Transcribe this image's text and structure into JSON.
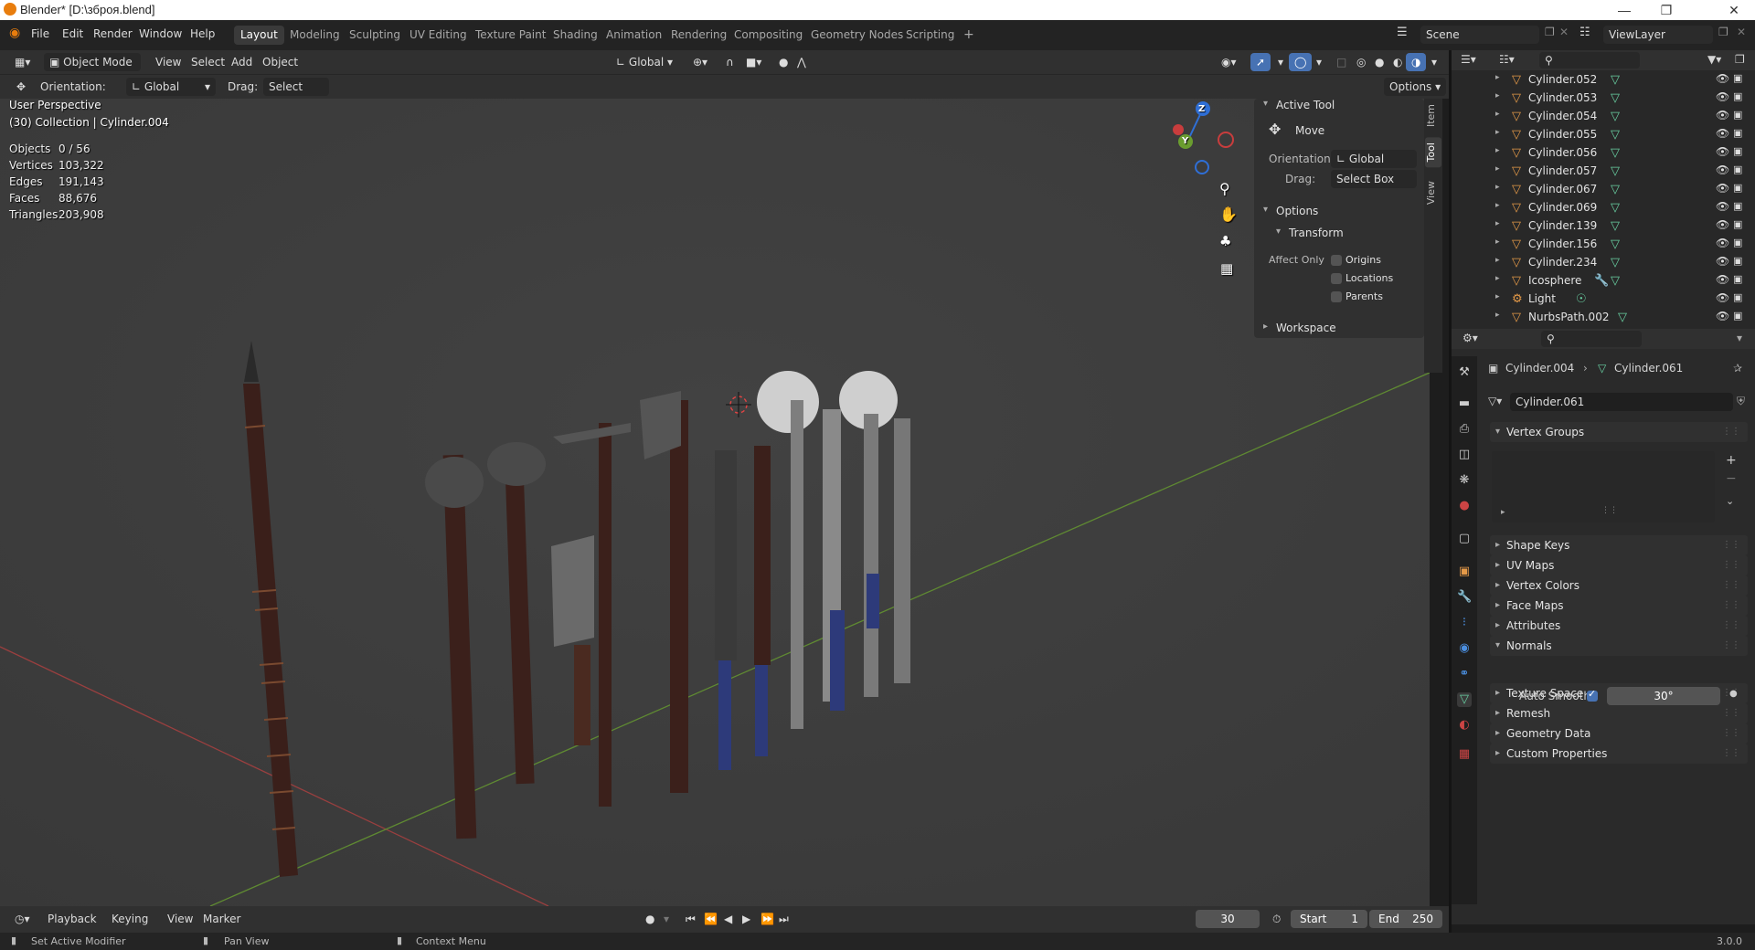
{
  "window": {
    "title": "Blender* [D:\\зброя.blend]"
  },
  "menu": {
    "items": [
      "File",
      "Edit",
      "Render",
      "Window",
      "Help"
    ],
    "workspaces": [
      "Layout",
      "Modeling",
      "Sculpting",
      "UV Editing",
      "Texture Paint",
      "Shading",
      "Animation",
      "Rendering",
      "Compositing",
      "Geometry Nodes",
      "Scripting"
    ],
    "active_workspace": "Layout",
    "add_tab": "+",
    "scene_name": "Scene",
    "view_layer": "ViewLayer"
  },
  "viewport_header": {
    "mode": "Object Mode",
    "menus": [
      "View",
      "Select",
      "Add",
      "Object"
    ],
    "transform_orientation": "Global"
  },
  "tool_header": {
    "orientation_label": "Orientation:",
    "orientation_value": "Global",
    "drag_label": "Drag:",
    "drag_value": "Select Box",
    "options_label": "Options"
  },
  "viewport": {
    "perspective": "User Perspective",
    "collection": "(30) Collection | Cylinder.004",
    "stats": [
      {
        "label": "Objects",
        "value": "0 / 56"
      },
      {
        "label": "Vertices",
        "value": "103,322"
      },
      {
        "label": "Edges",
        "value": "191,143"
      },
      {
        "label": "Faces",
        "value": "88,676"
      },
      {
        "label": "Triangles",
        "value": "203,908"
      }
    ],
    "gizmo_labels": {
      "z": "Z",
      "y": "Y"
    }
  },
  "npanel": {
    "tabs": [
      "Item",
      "Tool",
      "View"
    ],
    "active_tab": "Tool",
    "active_tool_title": "Active Tool",
    "tool_name": "Move",
    "orientation_label": "Orientation",
    "orientation_value": "Global",
    "drag_label": "Drag:",
    "drag_value": "Select Box",
    "options_title": "Options",
    "transform_title": "Transform",
    "affect_only_label": "Affect Only",
    "affect_only": [
      "Origins",
      "Locations",
      "Parents"
    ],
    "workspace_title": "Workspace"
  },
  "outliner": {
    "rows": [
      {
        "name": "Cylinder.052",
        "type": "mesh"
      },
      {
        "name": "Cylinder.053",
        "type": "mesh"
      },
      {
        "name": "Cylinder.054",
        "type": "mesh"
      },
      {
        "name": "Cylinder.055",
        "type": "mesh"
      },
      {
        "name": "Cylinder.056",
        "type": "mesh"
      },
      {
        "name": "Cylinder.057",
        "type": "mesh"
      },
      {
        "name": "Cylinder.067",
        "type": "mesh"
      },
      {
        "name": "Cylinder.069",
        "type": "mesh"
      },
      {
        "name": "Cylinder.139",
        "type": "mesh"
      },
      {
        "name": "Cylinder.156",
        "type": "mesh"
      },
      {
        "name": "Cylinder.234",
        "type": "mesh"
      },
      {
        "name": "Icosphere",
        "type": "mesh-modifier"
      },
      {
        "name": "Light",
        "type": "light"
      },
      {
        "name": "NurbsPath.002",
        "type": "curve"
      }
    ]
  },
  "properties": {
    "breadcrumb_object": "Cylinder.004",
    "breadcrumb_data": "Cylinder.061",
    "data_name": "Cylinder.061",
    "sections": [
      {
        "label": "Vertex Groups",
        "open": true
      },
      {
        "label": "Shape Keys",
        "open": false
      },
      {
        "label": "UV Maps",
        "open": false
      },
      {
        "label": "Vertex Colors",
        "open": false
      },
      {
        "label": "Face Maps",
        "open": false
      },
      {
        "label": "Attributes",
        "open": false
      },
      {
        "label": "Normals",
        "open": true
      },
      {
        "label": "Texture Space",
        "open": false
      },
      {
        "label": "Remesh",
        "open": false
      },
      {
        "label": "Geometry Data",
        "open": false
      },
      {
        "label": "Custom Properties",
        "open": false
      }
    ],
    "auto_smooth_label": "Auto Smooth",
    "auto_smooth_angle": "30°",
    "auto_smooth_enabled": true
  },
  "timeline": {
    "menus": [
      "Playback",
      "Keying",
      "View",
      "Marker"
    ],
    "current_frame": "30",
    "start_label": "Start",
    "start": "1",
    "end_label": "End",
    "end": "250"
  },
  "statusbar": {
    "items": [
      "Set Active Modifier",
      "Pan View",
      "Context Menu"
    ],
    "version": "3.0.0"
  },
  "colors": {
    "accent": "#4772b3",
    "mesh_icon": "#69d0a2",
    "object_icon": "#e59a48"
  }
}
